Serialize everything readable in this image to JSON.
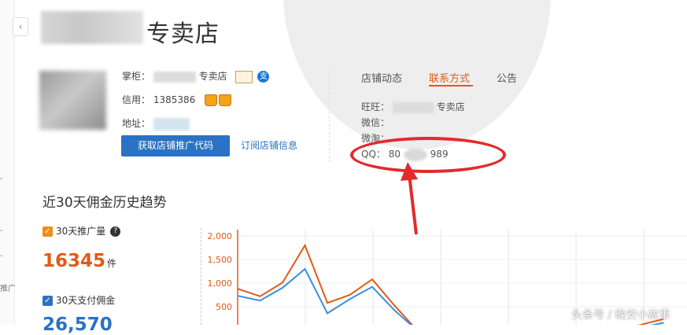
{
  "nav": {
    "back_arrow": "‹"
  },
  "side_fragments": [
    "-",
    "-",
    "-",
    "推广"
  ],
  "shop": {
    "title": "专卖店",
    "keeper_label": "掌柜：",
    "keeper_suffix": "专卖店",
    "credit_label": "信用：",
    "credit_value": "1385386",
    "address_label": "地址：",
    "promo_button": "获取店铺推广代码",
    "subscribe_link": "订阅店铺信息"
  },
  "tabs": [
    {
      "label": "店铺动态",
      "active": false
    },
    {
      "label": "联系方式",
      "active": true
    },
    {
      "label": "公告",
      "active": false
    }
  ],
  "contact": {
    "wangwang_label": "旺旺：",
    "wangwang_suffix": "专卖店",
    "weixin_label": "微信：",
    "weitao_label": "微淘：",
    "qq_label": "QQ：",
    "qq_prefix": "80",
    "qq_suffix": "989"
  },
  "section": {
    "title": "近30天佣金历史趋势",
    "metric1_label": "30天推广量",
    "metric1_value": "16345",
    "metric1_unit": "件",
    "metric2_label": "30天支付佣金",
    "metric2_value": "26,570"
  },
  "icons": {
    "checkbox_mark": "✓",
    "help": "?",
    "alipay": "支"
  },
  "colors": {
    "accent_orange": "#e25a18",
    "link_blue": "#2a72c3",
    "annotation_red": "#e32a2a",
    "series_blue": "#3a8fde"
  },
  "chart_data": {
    "type": "line",
    "yticks": [
      "2,000",
      "1,500",
      "1,000",
      "500"
    ],
    "ylim": [
      0,
      2000
    ],
    "grid": true,
    "series": [
      {
        "color": "#e25a18",
        "values": [
          880,
          720,
          1010,
          1800,
          580,
          750,
          1080,
          520,
          0,
          0,
          0,
          0,
          0,
          0,
          0,
          0,
          0,
          0,
          120,
          240
        ]
      },
      {
        "color": "#3a8fde",
        "values": [
          730,
          630,
          900,
          1300,
          360,
          660,
          920,
          420,
          0,
          0,
          0,
          0,
          0,
          0,
          0,
          0,
          0,
          0,
          60,
          160
        ]
      }
    ]
  },
  "watermark": "头条号 / 晚安小故事"
}
